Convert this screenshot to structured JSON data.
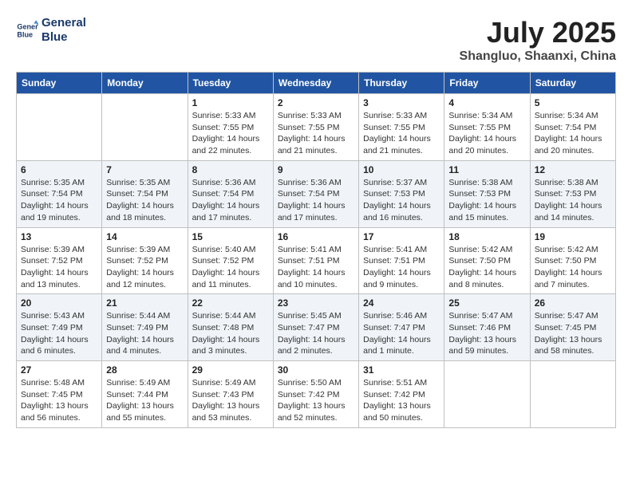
{
  "header": {
    "logo_line1": "General",
    "logo_line2": "Blue",
    "month": "July 2025",
    "location": "Shangluo, Shaanxi, China"
  },
  "weekdays": [
    "Sunday",
    "Monday",
    "Tuesday",
    "Wednesday",
    "Thursday",
    "Friday",
    "Saturday"
  ],
  "weeks": [
    [
      {
        "day": "",
        "info": ""
      },
      {
        "day": "",
        "info": ""
      },
      {
        "day": "1",
        "info": "Sunrise: 5:33 AM\nSunset: 7:55 PM\nDaylight: 14 hours\nand 22 minutes."
      },
      {
        "day": "2",
        "info": "Sunrise: 5:33 AM\nSunset: 7:55 PM\nDaylight: 14 hours\nand 21 minutes."
      },
      {
        "day": "3",
        "info": "Sunrise: 5:33 AM\nSunset: 7:55 PM\nDaylight: 14 hours\nand 21 minutes."
      },
      {
        "day": "4",
        "info": "Sunrise: 5:34 AM\nSunset: 7:55 PM\nDaylight: 14 hours\nand 20 minutes."
      },
      {
        "day": "5",
        "info": "Sunrise: 5:34 AM\nSunset: 7:54 PM\nDaylight: 14 hours\nand 20 minutes."
      }
    ],
    [
      {
        "day": "6",
        "info": "Sunrise: 5:35 AM\nSunset: 7:54 PM\nDaylight: 14 hours\nand 19 minutes."
      },
      {
        "day": "7",
        "info": "Sunrise: 5:35 AM\nSunset: 7:54 PM\nDaylight: 14 hours\nand 18 minutes."
      },
      {
        "day": "8",
        "info": "Sunrise: 5:36 AM\nSunset: 7:54 PM\nDaylight: 14 hours\nand 17 minutes."
      },
      {
        "day": "9",
        "info": "Sunrise: 5:36 AM\nSunset: 7:54 PM\nDaylight: 14 hours\nand 17 minutes."
      },
      {
        "day": "10",
        "info": "Sunrise: 5:37 AM\nSunset: 7:53 PM\nDaylight: 14 hours\nand 16 minutes."
      },
      {
        "day": "11",
        "info": "Sunrise: 5:38 AM\nSunset: 7:53 PM\nDaylight: 14 hours\nand 15 minutes."
      },
      {
        "day": "12",
        "info": "Sunrise: 5:38 AM\nSunset: 7:53 PM\nDaylight: 14 hours\nand 14 minutes."
      }
    ],
    [
      {
        "day": "13",
        "info": "Sunrise: 5:39 AM\nSunset: 7:52 PM\nDaylight: 14 hours\nand 13 minutes."
      },
      {
        "day": "14",
        "info": "Sunrise: 5:39 AM\nSunset: 7:52 PM\nDaylight: 14 hours\nand 12 minutes."
      },
      {
        "day": "15",
        "info": "Sunrise: 5:40 AM\nSunset: 7:52 PM\nDaylight: 14 hours\nand 11 minutes."
      },
      {
        "day": "16",
        "info": "Sunrise: 5:41 AM\nSunset: 7:51 PM\nDaylight: 14 hours\nand 10 minutes."
      },
      {
        "day": "17",
        "info": "Sunrise: 5:41 AM\nSunset: 7:51 PM\nDaylight: 14 hours\nand 9 minutes."
      },
      {
        "day": "18",
        "info": "Sunrise: 5:42 AM\nSunset: 7:50 PM\nDaylight: 14 hours\nand 8 minutes."
      },
      {
        "day": "19",
        "info": "Sunrise: 5:42 AM\nSunset: 7:50 PM\nDaylight: 14 hours\nand 7 minutes."
      }
    ],
    [
      {
        "day": "20",
        "info": "Sunrise: 5:43 AM\nSunset: 7:49 PM\nDaylight: 14 hours\nand 6 minutes."
      },
      {
        "day": "21",
        "info": "Sunrise: 5:44 AM\nSunset: 7:49 PM\nDaylight: 14 hours\nand 4 minutes."
      },
      {
        "day": "22",
        "info": "Sunrise: 5:44 AM\nSunset: 7:48 PM\nDaylight: 14 hours\nand 3 minutes."
      },
      {
        "day": "23",
        "info": "Sunrise: 5:45 AM\nSunset: 7:47 PM\nDaylight: 14 hours\nand 2 minutes."
      },
      {
        "day": "24",
        "info": "Sunrise: 5:46 AM\nSunset: 7:47 PM\nDaylight: 14 hours\nand 1 minute."
      },
      {
        "day": "25",
        "info": "Sunrise: 5:47 AM\nSunset: 7:46 PM\nDaylight: 13 hours\nand 59 minutes."
      },
      {
        "day": "26",
        "info": "Sunrise: 5:47 AM\nSunset: 7:45 PM\nDaylight: 13 hours\nand 58 minutes."
      }
    ],
    [
      {
        "day": "27",
        "info": "Sunrise: 5:48 AM\nSunset: 7:45 PM\nDaylight: 13 hours\nand 56 minutes."
      },
      {
        "day": "28",
        "info": "Sunrise: 5:49 AM\nSunset: 7:44 PM\nDaylight: 13 hours\nand 55 minutes."
      },
      {
        "day": "29",
        "info": "Sunrise: 5:49 AM\nSunset: 7:43 PM\nDaylight: 13 hours\nand 53 minutes."
      },
      {
        "day": "30",
        "info": "Sunrise: 5:50 AM\nSunset: 7:42 PM\nDaylight: 13 hours\nand 52 minutes."
      },
      {
        "day": "31",
        "info": "Sunrise: 5:51 AM\nSunset: 7:42 PM\nDaylight: 13 hours\nand 50 minutes."
      },
      {
        "day": "",
        "info": ""
      },
      {
        "day": "",
        "info": ""
      }
    ]
  ]
}
